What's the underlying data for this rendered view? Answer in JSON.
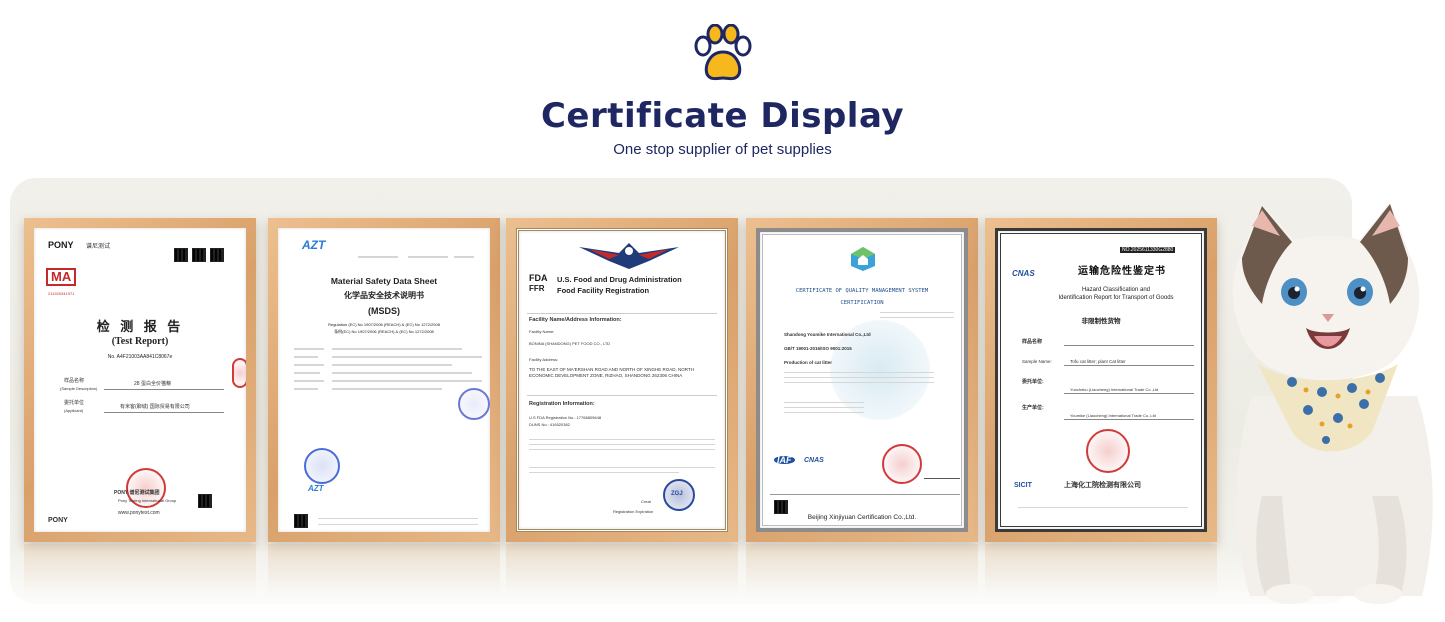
{
  "header": {
    "title": "Certificate Display",
    "subtitle": "One stop supplier of pet supplies",
    "icon": "paw-icon",
    "accent": "#f6b81c",
    "title_color": "#1e2761"
  },
  "certificates": [
    {
      "logo": "PONY",
      "logo_sub": "谱尼测试",
      "cma": "MA",
      "cma_code": "211920341971",
      "title_cn": "检 测 报 告",
      "title_en": "(Test Report)",
      "report_no": "No. A4F21003AA841C8067e",
      "sample_label_cn": "样品名称",
      "sample_label_en": "(Sample Description)",
      "sample_value": "28 蛋白全价猫粮",
      "applicant_label_cn": "委托单位",
      "applicant_label_en": "(Applicant)",
      "applicant_value": "有米客(聊城) 国际贸易有限公司",
      "group": "PONY 谱尼测试集团",
      "group_en": "Pony Testing International Group",
      "website": "www.ponytest.com"
    },
    {
      "logo": "AZT",
      "title_en": "Material Safety Data Sheet",
      "title_cn": "化学品安全技术说明书",
      "title_abbr": "(MSDS)",
      "regulation_1": "Regulation (EC) No 1907/2006 (REACH) & (EC) No 1272/2008",
      "regulation_2": "条例(EC) No 1907/2006 (REACH) & (EC) No 1272/2008"
    },
    {
      "logo": "FDA",
      "logo_sub": "FFR",
      "title_1": "U.S. Food and Drug Administration",
      "title_2": "Food Facility Registration",
      "section_1": "Facility Name/Address Information:",
      "facility_name_label": "Facility Name:",
      "facility_name": "BONINA (SHANDONG) PET FOOD CO., LTD",
      "facility_address_label": "Facility Address:",
      "facility_address": "TO THE EAST OF MA'ERSHAN ROAD AND NORTH OF XINGHE ROAD, NORTH ECONOMIC DEVELOPMENT ZONE, RIZHAO, SHANDONG 262306 CHINA",
      "section_2": "Registration Information:",
      "reg_no": "U.S FDA Registration No.: 17768809648",
      "duns": "DUNS No.: 416520382",
      "seal": "ZGJ",
      "created": "Creat",
      "expiration": "Registration Expiration"
    },
    {
      "title_1": "CERTIFICATE OF QUALITY MANAGEMENT SYSTEM",
      "title_2": "CERTIFICATION",
      "company": "Shandong Youmike International Co.,Ltd",
      "standard": "GB/T 19001-2016/ISO 9001:2015",
      "scope": "Production of cat litter",
      "iaf": "IAF",
      "cnas": "CNAS",
      "issuer": "Beijing Xinjiyuan Certification Co.,Ltd."
    },
    {
      "cert_no": "NO.2025611330G2880",
      "cnas": "CNAS",
      "title_cn": "运输危险性鉴定书",
      "title_en_1": "Hazard Classification and",
      "title_en_2": "Identification Report for Transport of Goods",
      "result_cn": "非限制性货物",
      "sample_label_cn": "样品名称",
      "sample_label_en": "Sample Name:",
      "sample_value": "Tofu cat litter;    plant Cat litter",
      "applicant_label_cn": "委托单位:",
      "applicant_value": "Yuncheku (Liaocheng) International Trade Co.,Ltd",
      "maker_label_cn": "生产单位:",
      "maker_value": "Youmike (Liaocheng) International Trade Co.,Ltd",
      "sicit": "SICIT",
      "institute": "上海化工院检测有限公司"
    }
  ]
}
